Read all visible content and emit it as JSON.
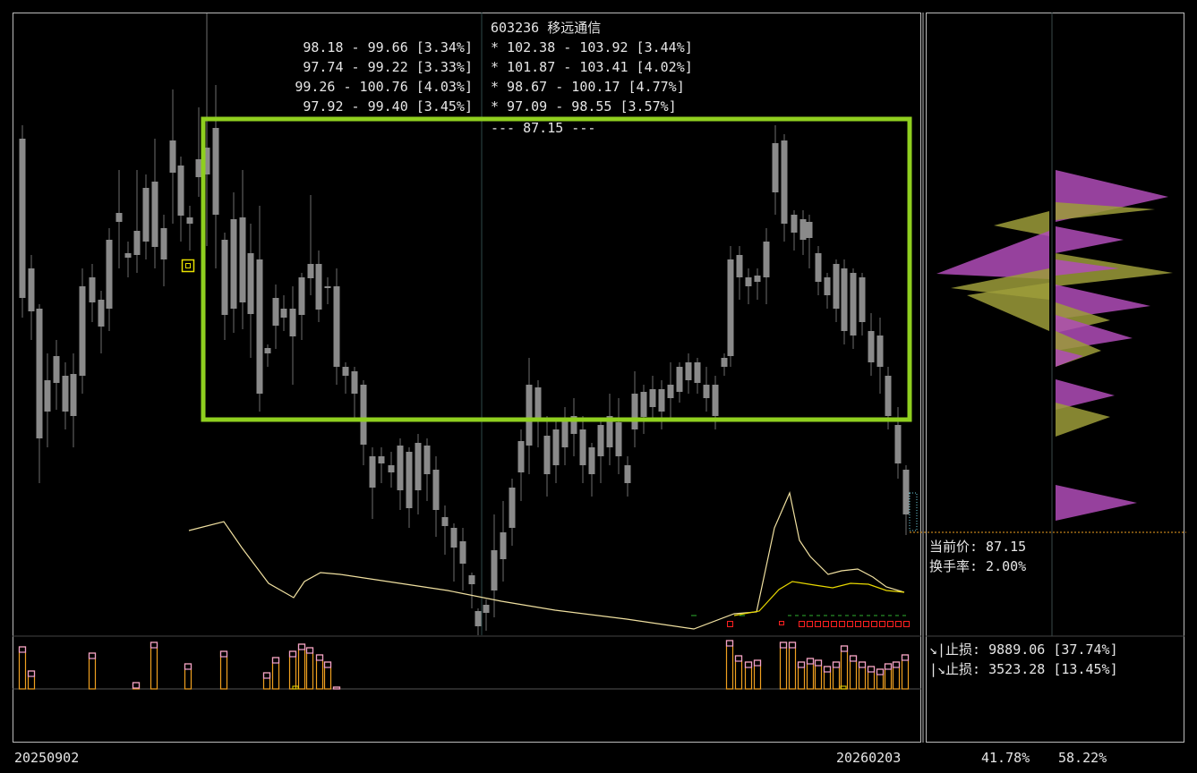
{
  "header": {
    "stock_code": "603236",
    "stock_name": "移远通信",
    "left_ranges": [
      "98.18 - 99.66 [3.34%]",
      "97.74 - 99.22 [3.33%]",
      "99.26 - 100.76 [4.03%]",
      "97.92 - 99.40 [3.45%]"
    ],
    "right_ranges": [
      "* 102.38 - 103.92 [3.44%]",
      "* 101.87 - 103.41 [4.02%]",
      "* 98.67 - 100.17 [4.77%]",
      "* 97.09 - 98.55 [3.57%]"
    ],
    "divider_line": "--- 87.15 ---"
  },
  "side_info": {
    "current_price": "当前价: 87.15",
    "turnover": "换手率: 2.00%",
    "stop_loss_down": "↘|止损: 9889.06 [37.74%]",
    "stop_loss_up": "|↘止损: 3523.28 [13.45%]"
  },
  "footer": {
    "start_date": "20250902",
    "end_date": "20260203",
    "pct_left": "41.78%",
    "pct_right": "58.22%"
  },
  "colors": {
    "candle": "#8a8a8a",
    "highlight_box": "#8fcf1f",
    "indicator_fast": "#f0e0a0",
    "indicator_slow": "#e8d800",
    "volume_bar": "#f0a020",
    "volume_top": "#f0a0d0",
    "profile_magenta": "#b04cb8",
    "profile_olive": "#9c9c3a",
    "current_price_line": "#f0a020",
    "signal_red": "#ff2020",
    "signal_green": "#30b030"
  },
  "chart_data": {
    "type": "candlestick",
    "current_price": 87.15,
    "candles_shown_as": "grey candlesticks, values not labelled",
    "start_date": "20250902",
    "end_date": "20260203"
  }
}
